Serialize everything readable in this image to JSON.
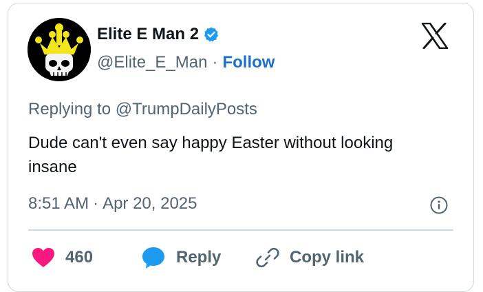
{
  "author": {
    "display_name": "Elite E Man 2",
    "handle": "@Elite_E_Man",
    "follow_label": "Follow",
    "separator": "·"
  },
  "reply_context": {
    "prefix": "Replying to",
    "mention": "@TrumpDailyPosts"
  },
  "tweet": {
    "text": "Dude can't even say happy Easter without looking insane",
    "time": "8:51 AM",
    "date_separator": "·",
    "date": "Apr 20, 2025"
  },
  "actions": {
    "like_count": "460",
    "reply_label": "Reply",
    "copy_label": "Copy link"
  },
  "colors": {
    "like": "#f91880",
    "reply": "#1d9bf0",
    "follow": "#1d70c9",
    "verified": "#1d9bf0",
    "secondary_text": "#536471",
    "border": "#cfd9de"
  },
  "icons": {
    "platform": "x-logo-icon",
    "verified": "verified-badge-icon",
    "info": "info-icon",
    "like": "heart-icon",
    "reply": "speech-bubble-icon",
    "copy": "link-icon"
  }
}
